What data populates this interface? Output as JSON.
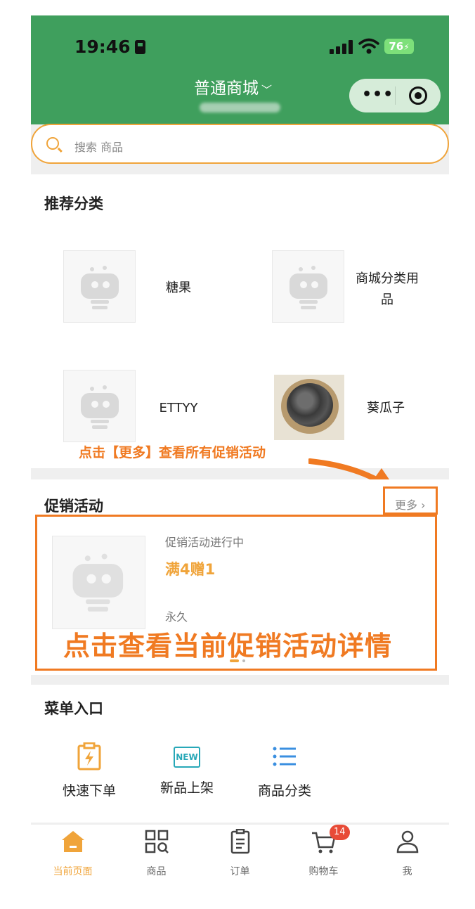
{
  "status": {
    "time": "19:46",
    "battery": "76"
  },
  "header": {
    "title": "普通商城"
  },
  "search": {
    "placeholder": "搜索 商品"
  },
  "recommended": {
    "title": "推荐分类",
    "items": [
      {
        "label": "糖果",
        "image": "placeholder-robot"
      },
      {
        "label": "商城分类用品",
        "image": "placeholder-robot"
      },
      {
        "label": "ETTYY",
        "image": "placeholder-robot"
      },
      {
        "label": "葵瓜子",
        "image": "sunflower-seeds-photo"
      }
    ]
  },
  "annotation_top": "点击【更多】查看所有促销活动",
  "promo": {
    "title": "促销活动",
    "more_label": "更多",
    "status": "促销活动进行中",
    "name": "满4赠1",
    "duration": "永久",
    "annotation": "点击查看当前促销活动详情"
  },
  "menu": {
    "title": "菜单入口",
    "items": [
      {
        "label": "快速下单",
        "icon": "quick-order-icon"
      },
      {
        "label": "新品上架",
        "icon": "new-badge-icon",
        "icon_text": "NEW"
      },
      {
        "label": "商品分类",
        "icon": "list-icon"
      }
    ]
  },
  "tabbar": {
    "items": [
      {
        "label": "当前页面",
        "icon": "home-icon",
        "active": true
      },
      {
        "label": "商品",
        "icon": "grid-search-icon"
      },
      {
        "label": "订单",
        "icon": "clipboard-icon"
      },
      {
        "label": "购物车",
        "icon": "cart-icon",
        "badge": "14"
      },
      {
        "label": "我",
        "icon": "user-icon"
      }
    ]
  },
  "colors": {
    "brand_green": "#3f9f5d",
    "accent_orange": "#f0a43a",
    "annotation_orange": "#f07a22",
    "badge_red": "#e84b37"
  }
}
